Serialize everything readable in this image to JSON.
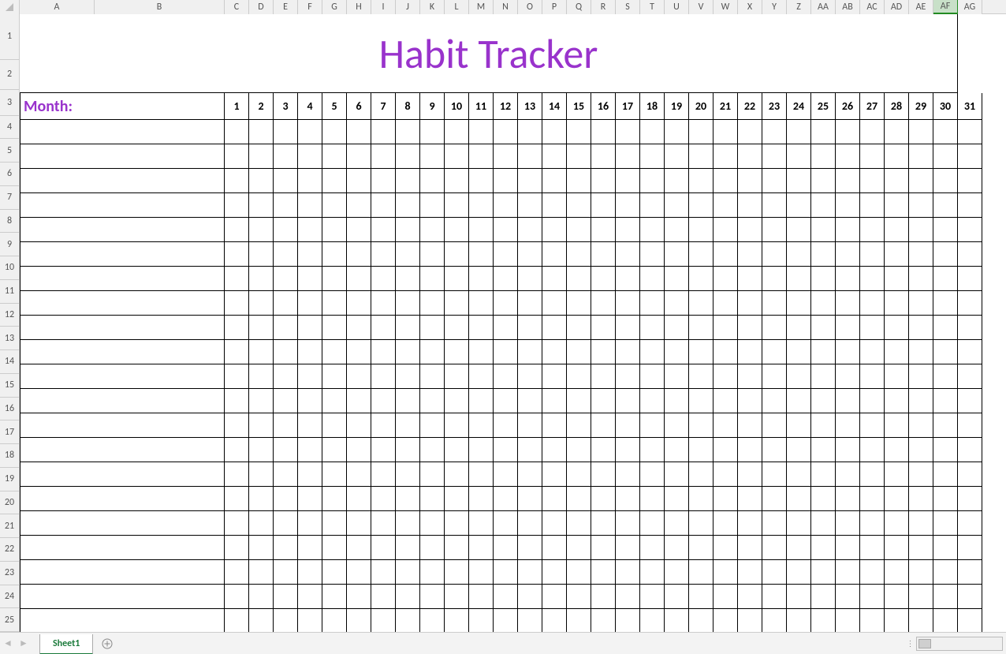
{
  "columns": {
    "labels": [
      "A",
      "B",
      "C",
      "D",
      "E",
      "F",
      "G",
      "H",
      "I",
      "J",
      "K",
      "L",
      "M",
      "N",
      "O",
      "P",
      "Q",
      "R",
      "S",
      "T",
      "U",
      "V",
      "W",
      "X",
      "Y",
      "Z",
      "AA",
      "AB",
      "AC",
      "AD",
      "AE",
      "AF",
      "AG"
    ],
    "selected": "AF"
  },
  "rows_visible": 25,
  "content": {
    "title": "Habit Tracker",
    "month_label": "Month:",
    "days": [
      1,
      2,
      3,
      4,
      5,
      6,
      7,
      8,
      9,
      10,
      11,
      12,
      13,
      14,
      15,
      16,
      17,
      18,
      19,
      20,
      21,
      22,
      23,
      24,
      25,
      26,
      27,
      28,
      29,
      30,
      31
    ]
  },
  "tabs": {
    "active": "Sheet1"
  },
  "colors": {
    "accent": "#9933cc",
    "tab_active": "#1a7a3a"
  }
}
